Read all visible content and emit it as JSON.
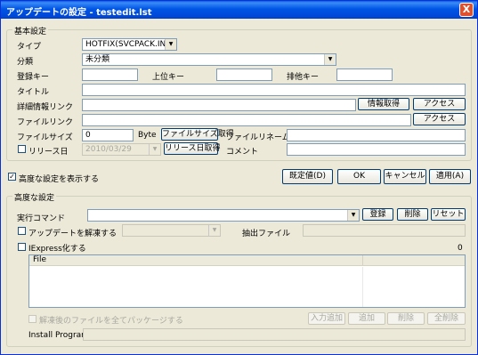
{
  "window": {
    "title": "アップデートの設定 - testedit.lst",
    "close_label": "X"
  },
  "basic": {
    "group_title": "基本設定",
    "type_label": "タイプ",
    "type_value": "HOTFIX(SVCPACK.INF)",
    "category_label": "分類",
    "category_value": "未分類",
    "reg_key_label": "登録キー",
    "parent_key_label": "上位キー",
    "exclusive_key_label": "排他キー",
    "title_label": "タイトル",
    "detail_link_label": "詳細情報リンク",
    "get_info_button": "情報取得",
    "access_button": "アクセス",
    "file_link_label": "ファイルリンク",
    "access_button2": "アクセス",
    "filesize_label": "ファイルサイズ",
    "filesize_value": "0",
    "byte_label": "Byte",
    "get_filesize_button": "ファイルサイズ取得",
    "file_rename_label": "ファイルリネーム",
    "release_date_label": "リリース日",
    "release_date_value": "2010/03/29",
    "get_release_date_button": "リリース日取得",
    "comment_label": "コメント"
  },
  "middle": {
    "show_advanced_label": "高度な設定を表示する",
    "show_advanced_checked": "✓",
    "default_button": "既定値(D)",
    "ok_button": "OK",
    "cancel_button": "キャンセル",
    "apply_button": "適用(A)"
  },
  "advanced": {
    "group_title": "高度な設定",
    "exec_command_label": "実行コマンド",
    "register_button": "登録",
    "delete_button": "削除",
    "reset_button": "リセット",
    "extract_update_label": "アップデートを解凍する",
    "extract_file_label": "抽出ファイル",
    "iexpress_label": "IExpress化する",
    "count_value": "0",
    "list_column_file": "File",
    "package_all_label": "解凍後のファイルを全てパッケージする",
    "input_add_button": "入力追加",
    "add_button": "追加",
    "remove_button": "削除",
    "remove_all_button": "全削除",
    "install_program_label": "Install Program"
  }
}
